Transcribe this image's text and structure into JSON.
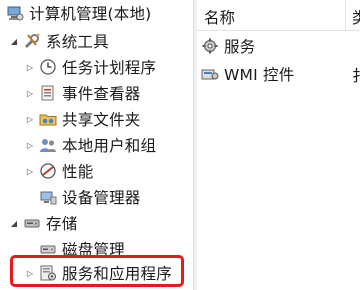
{
  "tree": {
    "root": {
      "label": "计算机管理(本地)"
    },
    "system_tools": {
      "label": "系统工具",
      "children": [
        {
          "label": "任务计划程序",
          "icon": "clock-icon"
        },
        {
          "label": "事件查看器",
          "icon": "event-viewer-icon"
        },
        {
          "label": "共享文件夹",
          "icon": "shared-folder-icon"
        },
        {
          "label": "本地用户和组",
          "icon": "users-icon"
        },
        {
          "label": "性能",
          "icon": "performance-icon"
        },
        {
          "label": "设备管理器",
          "icon": "device-manager-icon"
        }
      ]
    },
    "storage": {
      "label": "存储",
      "children": [
        {
          "label": "磁盘管理",
          "icon": "disk-icon"
        }
      ]
    },
    "services_apps": {
      "label": "服务和应用程序",
      "icon": "services-apps-icon"
    }
  },
  "list": {
    "columns": [
      "名称",
      "类"
    ],
    "items": [
      {
        "name": "服务",
        "icon": "gear-icon"
      },
      {
        "name": "WMI 控件",
        "icon": "wmi-icon",
        "type_fragment": "扌"
      }
    ]
  },
  "colors": {
    "highlight_border": "#e51b1b"
  }
}
